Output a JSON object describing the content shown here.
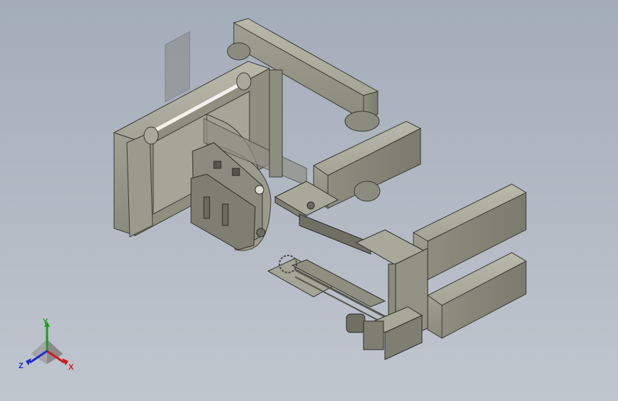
{
  "viewport": {
    "background_top": "#a3acb9",
    "background_bottom": "#c0c6ce",
    "model_color": "#9a9a8c",
    "model_shadow": "#6e6e63",
    "model_light": "#b4b4a6"
  },
  "triad": {
    "x_label": "X",
    "y_label": "Y",
    "z_label": "Z",
    "x_color": "#d01818",
    "y_color": "#18a018",
    "z_color": "#1c2ad0"
  }
}
